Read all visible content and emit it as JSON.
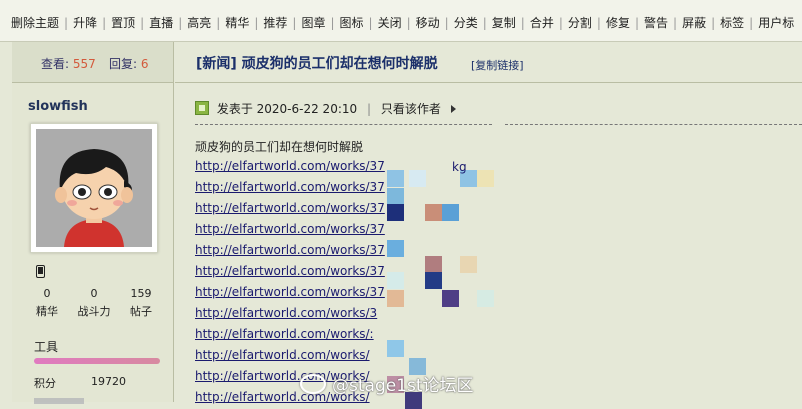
{
  "toolbar": {
    "items": [
      "删除主题",
      "升降",
      "置顶",
      "直播",
      "高亮",
      "精华",
      "推荐",
      "图章",
      "图标",
      "关闭",
      "移动",
      "分类",
      "复制",
      "合并",
      "分割",
      "修复",
      "警告",
      "屏蔽",
      "标签",
      "用户标"
    ]
  },
  "stats": {
    "views_label": "查看:",
    "views": "557",
    "replies_label": "回复:",
    "replies": "6"
  },
  "user": {
    "name": "slowfish",
    "numbers": [
      {
        "value": "0",
        "label": "精华"
      },
      {
        "value": "0",
        "label": "战斗力"
      },
      {
        "value": "159",
        "label": "帖子"
      }
    ],
    "tool_label": "工具",
    "tool_progress": 1.0,
    "points_label": "积分",
    "points": "19720"
  },
  "thread": {
    "title": "[新闻] 顽皮狗的员工们却在想何时解脱",
    "copy_link": "[复制链接]",
    "posted_label": "发表于 2020-6-22 20:10",
    "only_author": "只看该作者"
  },
  "post": {
    "first_line": "顽皮狗的员工们却在想何时解脱",
    "links": [
      "http://elfartworld.com/works/37",
      "http://elfartworld.com/works/37",
      "http://elfartworld.com/works/37",
      "http://elfartworld.com/works/37",
      "http://elfartworld.com/works/37",
      "http://elfartworld.com/works/37",
      "http://elfartworld.com/works/37",
      "http://elfartworld.com/works/3",
      "http://elfartworld.com/works/:",
      "http://elfartworld.com/works/",
      "http://elfartworld.com/works/",
      "http://elfartworld.com/works/"
    ],
    "partial_text": "kg"
  },
  "watermark": "@stage1st论坛区",
  "colors": {
    "link": "#1a1a6e",
    "title": "#1b2f6a",
    "red": "#d35a3c",
    "bg": "#e5e8d7"
  }
}
